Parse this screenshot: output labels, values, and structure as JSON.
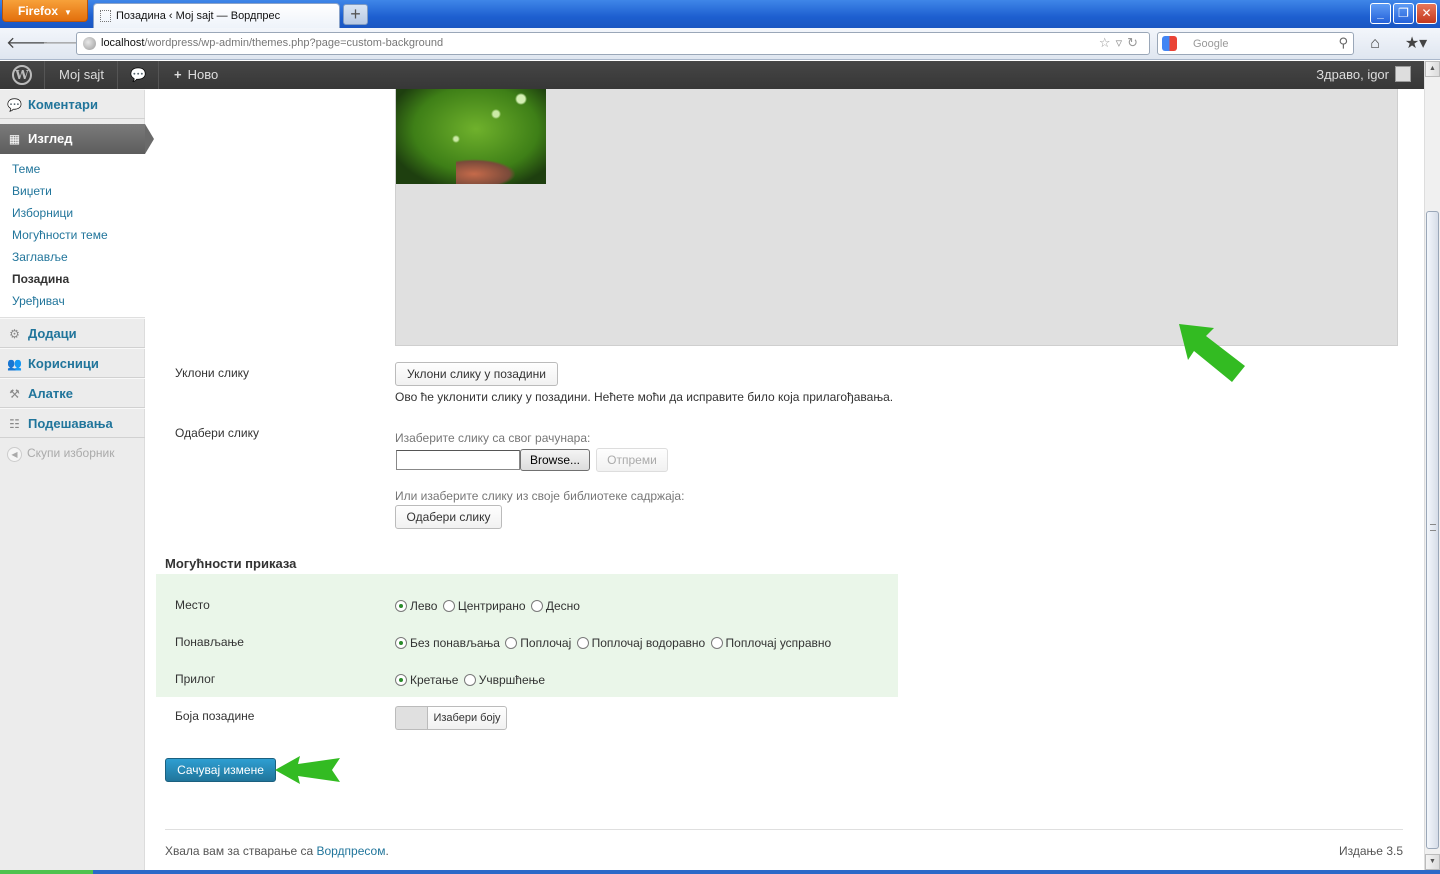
{
  "browser": {
    "menu_button": "Firefox",
    "tab_title": "Позадина ‹ Мој sajt — Вордпрес",
    "url_host": "localhost",
    "url_path": "/wordpress/wp-admin/themes.php?page=custom-background",
    "search_engine": "Google"
  },
  "adminbar": {
    "site_name": "Мој sajt",
    "new_label": "Ново",
    "howdy": "Здраво, igor"
  },
  "sidebar": {
    "comments": "Коментари",
    "appearance": "Изглед",
    "submenu": [
      "Теме",
      "Виџети",
      "Изборници",
      "Могућности теме",
      "Заглавље",
      "Позадина",
      "Уређивач"
    ],
    "current_submenu": "Позадина",
    "plugins": "Додаци",
    "users": "Корисници",
    "tools": "Алатке",
    "settings": "Подешавања",
    "collapse": "Скупи изборник"
  },
  "background_image": {
    "remove_label": "Уклони слику",
    "remove_button": "Уклони слику у позадини",
    "remove_description": "Ово ће уклонити слику у позадини. Нећете моћи да исправите било која прилагођавања.",
    "select_label": "Одабери слику",
    "upload_hint": "Изаберите слику са свог рачунара:",
    "browse_button": "Browse...",
    "upload_button": "Отпреми",
    "library_hint": "Или изаберите слику из своје библиотеке садржаја:",
    "library_button": "Одабери слику"
  },
  "display_options": {
    "title": "Могућности приказа",
    "position": {
      "label": "Место",
      "options": [
        "Лево",
        "Центрирано",
        "Десно"
      ],
      "selected": 0
    },
    "repeat": {
      "label": "Понављање",
      "options": [
        "Без понављања",
        "Поплочај",
        "Поплочај водоравно",
        "Поплочај усправно"
      ],
      "selected": 0
    },
    "attachment": {
      "label": "Прилог",
      "options": [
        "Кретање",
        "Учвршћење"
      ],
      "selected": 0
    },
    "color": {
      "label": "Боја позадине",
      "button": "Изабери боју",
      "swatch": "#e0e0e0"
    }
  },
  "save_button": "Сачувај измене",
  "footer": {
    "thanks_prefix": "Хвала вам за стварање са ",
    "thanks_link": "Вордпресом",
    "thanks_suffix": ".",
    "version": "Издање 3.5"
  },
  "colors": {
    "link": "#21759b",
    "options_bg": "#eaf6e9",
    "arrow": "#33bb22",
    "adminbar": "#464646"
  }
}
